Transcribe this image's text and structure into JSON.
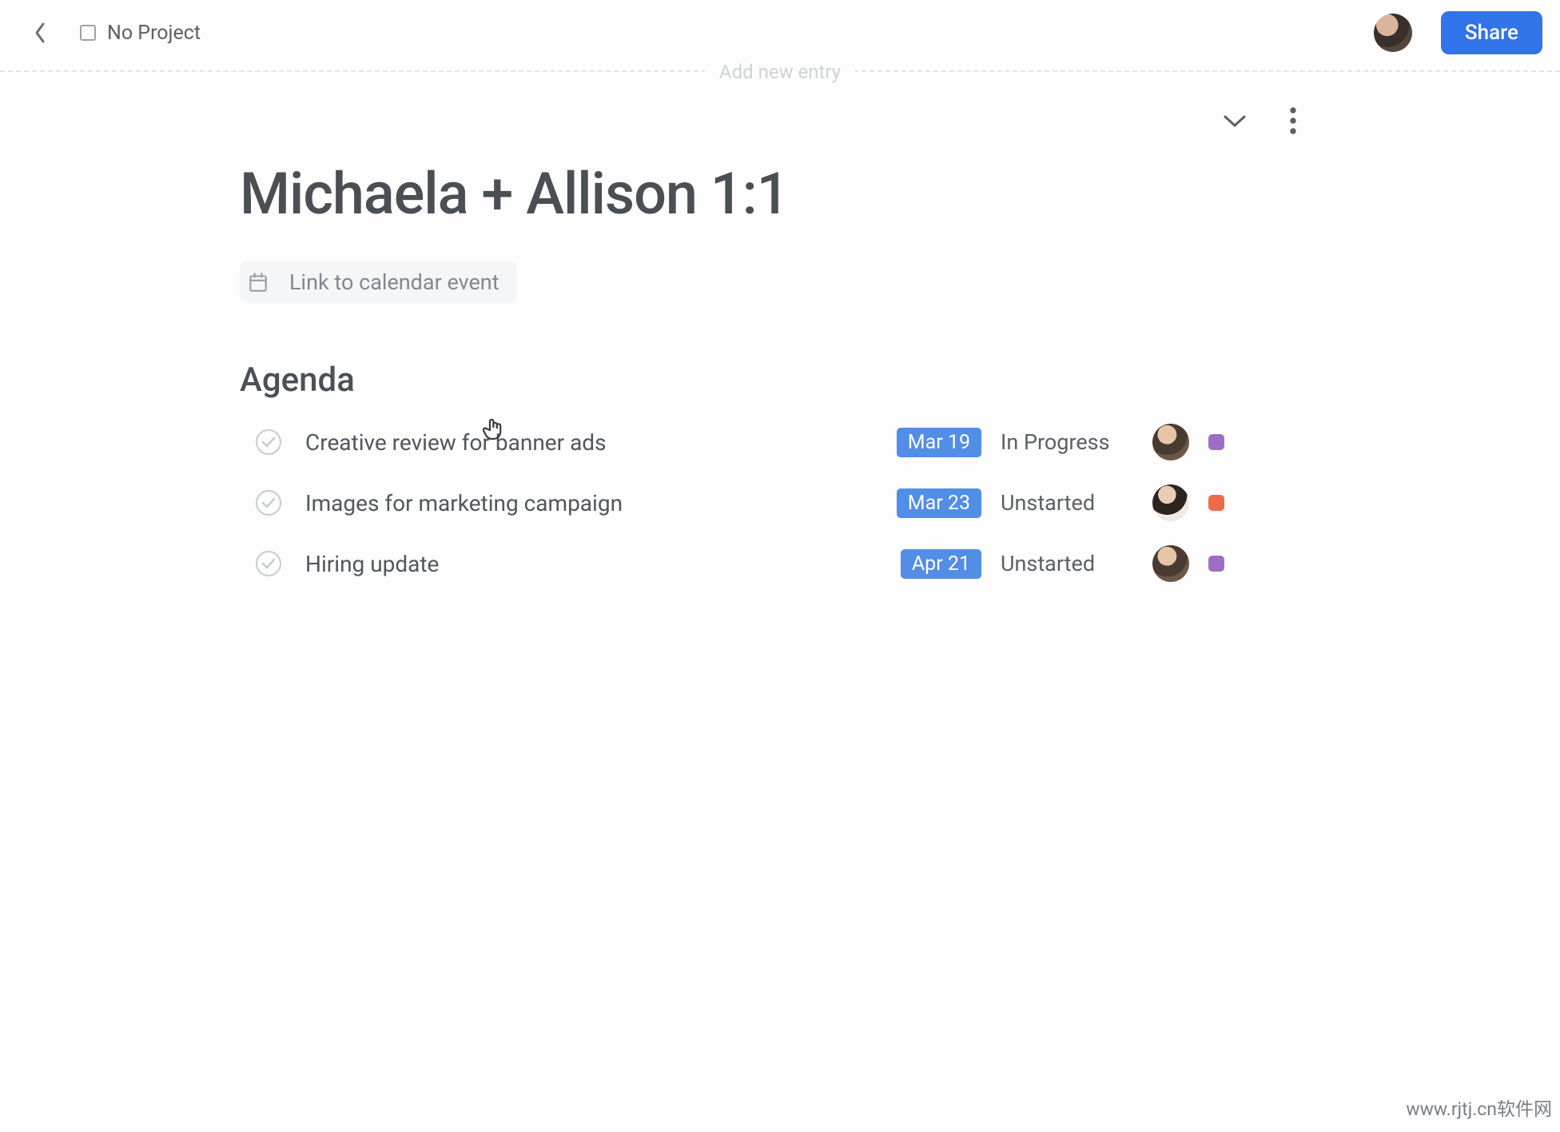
{
  "topbar": {
    "project_label": "No Project",
    "share_label": "Share",
    "add_entry_label": "Add new entry"
  },
  "page": {
    "title": "Michaela + Allison 1:1",
    "calendar_link_label": "Link to calendar event",
    "agenda_heading": "Agenda"
  },
  "agenda": {
    "items": [
      {
        "title": "Creative review for banner ads",
        "date": "Mar 19",
        "status": "In Progress",
        "avatar_class": "av-a",
        "dot_class": "dot-purple"
      },
      {
        "title": "Images for marketing campaign",
        "date": "Mar 23",
        "status": "Unstarted",
        "avatar_class": "av-b",
        "dot_class": "dot-orange"
      },
      {
        "title": "Hiring update",
        "date": "Apr 21",
        "status": "Unstarted",
        "avatar_class": "av-a",
        "dot_class": "dot-purple"
      }
    ]
  },
  "footer": {
    "watermark": "www.rjtj.cn软件网"
  }
}
